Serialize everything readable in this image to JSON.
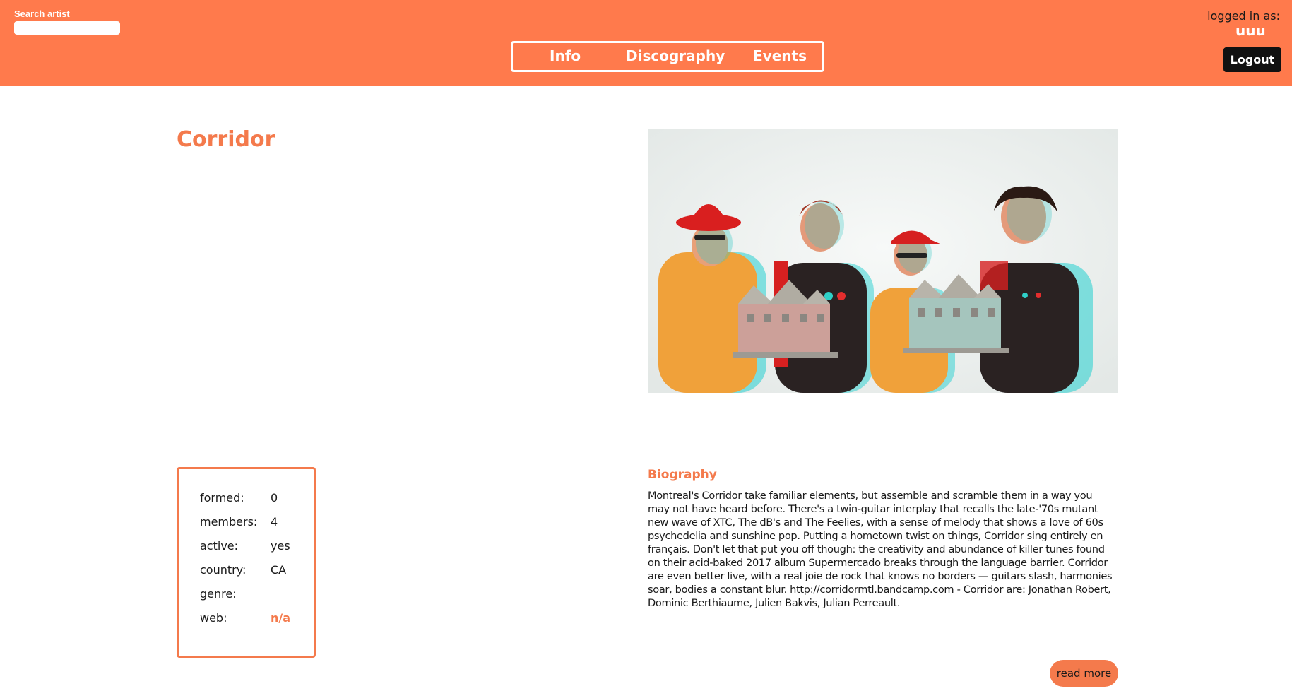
{
  "header": {
    "search_label": "Search artist",
    "search_placeholder": "",
    "search_value": "",
    "nav": {
      "info": "Info",
      "discography": "Discography",
      "events": "Events"
    },
    "logged_in_label": "logged in as:",
    "username": "uuu",
    "logout_label": "Logout"
  },
  "artist": {
    "name": "Corridor",
    "photo_icon": "band-photo"
  },
  "info": {
    "formed_label": "formed:",
    "formed_value": "0",
    "members_label": "members:",
    "members_value": "4",
    "active_label": "active:",
    "active_value": "yes",
    "country_label": "country:",
    "country_value": "CA",
    "genre_label": "genre:",
    "genre_value": "",
    "web_label": "web:",
    "web_value": "n/a"
  },
  "biography": {
    "heading": "Biography",
    "text": "Montreal's Corridor take familiar elements, but assemble and scramble them in a way you may not have heard before. There's a twin-guitar interplay that recalls the late-'70s mutant new wave of XTC, The dB's and The Feelies, with a sense of melody that shows a love of 60s psychedelia and sunshine pop. Putting a hometown twist on things, Corridor sing entirely en français. Don't let that put you off though: the creativity and abundance of killer tunes found on their acid-baked 2017 album Supermercado breaks through the language barrier. Corridor are even better live, with a real joie de rock that knows no borders — guitars slash, harmonies soar, bodies a constant blur. http://corridormtl.bandcamp.com - Corridor are: Jonathan Robert, Dominic Berthiaume, Julien Bakvis, Julian Perreault.",
    "read_more_label": "read more"
  },
  "colors": {
    "brand_orange": "#ff7a4c",
    "accent_orange": "#f47a4c",
    "dark_button": "#111111"
  }
}
